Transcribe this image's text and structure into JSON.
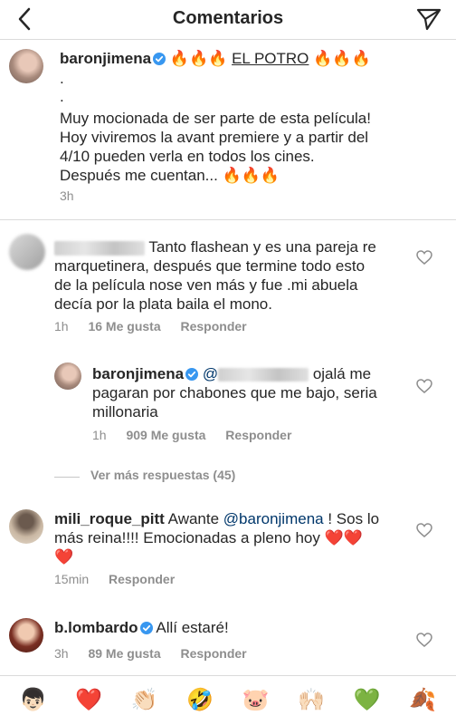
{
  "header": {
    "title": "Comentarios"
  },
  "caption": {
    "username": "baronjimena",
    "fire_prefix": "🔥🔥🔥",
    "potro": "EL POTRO",
    "fire_suffix": "🔥🔥🔥",
    "dot1": ".",
    "dot2": ".",
    "line1": "Muy mocionada de ser parte de esta película!",
    "line2": "Hoy viviremos la avant premiere y a partir del",
    "line3": "4/10 pueden verla en todos los cines.",
    "line4": "Después me cuentan... 🔥🔥🔥",
    "time": "3h"
  },
  "comment1": {
    "text_a": "Tanto flashean  y es una pareja re",
    "text_b": "marquetinera, después que termine todo esto",
    "text_c": "de la película nose ven más y fue .mi abuela",
    "text_d": "decía por la plata baila el mono.",
    "time": "1h",
    "likes": "16 Me gusta",
    "reply": "Responder"
  },
  "reply1": {
    "username": "baronjimena",
    "mention_prefix": "@",
    "text_a": "ojalá me",
    "text_b": "pagaran por chabones que me bajo, seria",
    "text_c": "millonaria",
    "time": "1h",
    "likes": "909 Me gusta",
    "reply": "Responder"
  },
  "more_replies": "Ver más respuestas (45)",
  "comment2": {
    "username": "mili_roque_pitt",
    "text_a": "Awante",
    "mention": "@baronjimena",
    "text_b": "! Sos lo",
    "text_c": "más reina!!!! Emocionadas a pleno hoy ❤️❤️",
    "text_d": "❤️",
    "time": "15min",
    "reply": "Responder"
  },
  "comment3": {
    "username": "b.lombardo",
    "text": "Allí estaré!",
    "time": "3h",
    "likes": "89 Me gusta",
    "reply": "Responder"
  },
  "emoji_bar": [
    "👦🏻",
    "❤️",
    "👏🏻",
    "🤣",
    "🐷",
    "🙌🏻",
    "💚",
    "🍂"
  ],
  "colors": {
    "link": "#00376b",
    "verified": "#3897f0",
    "meta": "#8e8e8e"
  }
}
